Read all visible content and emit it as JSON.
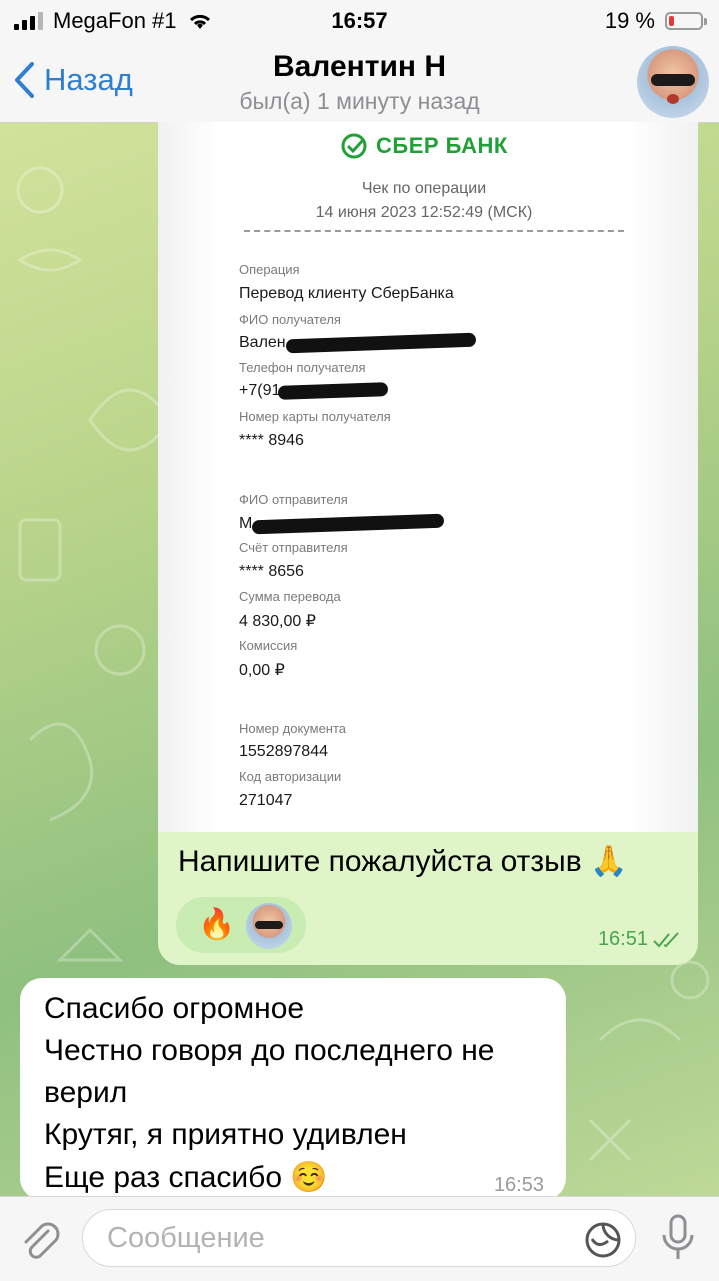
{
  "status_bar": {
    "carrier": "MegaFon #1",
    "time": "16:57",
    "battery": "19 %"
  },
  "nav": {
    "back_label": "Назад",
    "contact_name": "Валентин Н",
    "last_seen": "был(а) 1 минуту назад"
  },
  "receipt": {
    "bank_name": "СБЕР БАНК",
    "heading": "Чек по операции",
    "datetime": "14 июня 2023 12:52:49 (МСК)",
    "operation_label": "Операция",
    "operation_value": "Перевод клиенту СберБанка",
    "recipient_name_label": "ФИО получателя",
    "recipient_name_value": "Вален",
    "recipient_phone_label": "Телефон получателя",
    "recipient_phone_value": "+7(91",
    "recipient_card_label": "Номер карты получателя",
    "recipient_card_value": "**** 8946",
    "sender_name_label": "ФИО отправителя",
    "sender_name_value": "М",
    "sender_account_label": "Счёт отправителя",
    "sender_account_value": "**** 8656",
    "amount_label": "Сумма перевода",
    "amount_value": "4 830,00 ₽",
    "fee_label": "Комиссия",
    "fee_value": "0,00 ₽",
    "doc_number_label": "Номер документа",
    "doc_number_value": "1552897844",
    "auth_code_label": "Код авторизации",
    "auth_code_value": "271047"
  },
  "outgoing_message": {
    "text": "Напишите пожалуйста отзыв 🙏",
    "reaction_emoji": "🔥",
    "time": "16:51"
  },
  "incoming_message": {
    "lines": [
      "Спасибо огромное",
      "Честно говоря до последнего не",
      "верил",
      "Крутяг, я приятно удивлен",
      "Еще раз спасибо ☺️"
    ],
    "time": "16:53"
  },
  "composer": {
    "placeholder": "Сообщение"
  },
  "colors": {
    "accent_blue": "#2f7fd1",
    "sber_green": "#21a038",
    "outgoing_bubble": "#dff5c8",
    "read_check_green": "#4ea34e"
  }
}
